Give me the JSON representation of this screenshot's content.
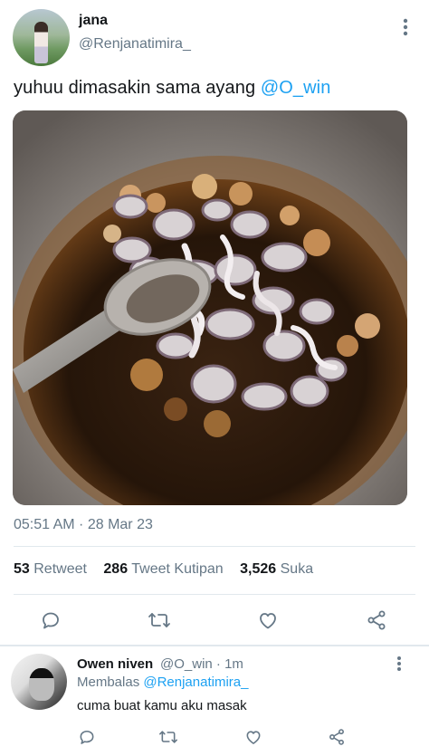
{
  "tweet": {
    "display_name": "jana",
    "username": "@Renjanatimira_",
    "text_main": "yuhuu dimasakin sama ayang ",
    "text_mention": "@O_win",
    "timestamp": "05:51 AM · 28 Mar 23",
    "stats": {
      "retweets_count": "53",
      "retweets_label": "Retweet",
      "quotes_count": "286",
      "quotes_label": "Tweet Kutipan",
      "likes_count": "3,526",
      "likes_label": "Suka"
    },
    "icons": {
      "more": "more-vertical-icon",
      "reply": "reply-icon",
      "retweet": "retweet-icon",
      "like": "heart-icon",
      "share": "share-icon"
    },
    "accent_color": "#1da1f2",
    "secondary_text_color": "#657786"
  },
  "reply": {
    "display_name": "Owen niven",
    "meta": "@O_win · 1m",
    "replying_label": "Membalas ",
    "replying_to": "@Renjanatimira_",
    "text": "cuma buat kamu aku masak"
  }
}
